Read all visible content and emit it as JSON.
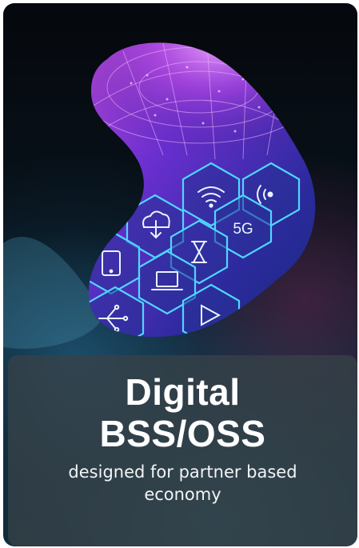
{
  "card": {
    "title_line1": "Digital",
    "title_line2": "BSS/OSS",
    "subtitle": "designed for partner based economy"
  },
  "artwork": {
    "hex_labels": {
      "network_5g": "5G"
    },
    "icons": [
      "wifi-icon",
      "signal-icon",
      "cloud-download-icon",
      "5g-icon",
      "hourglass-icon",
      "tablet-icon",
      "laptop-icon",
      "circuit-icon",
      "play-icon",
      "globe-icon"
    ]
  },
  "colors": {
    "hex_glow": "#4fd6ff",
    "blob_purple": "#6a2fd0",
    "blob_magenta": "#b03adf",
    "panel": "#3a454c"
  }
}
